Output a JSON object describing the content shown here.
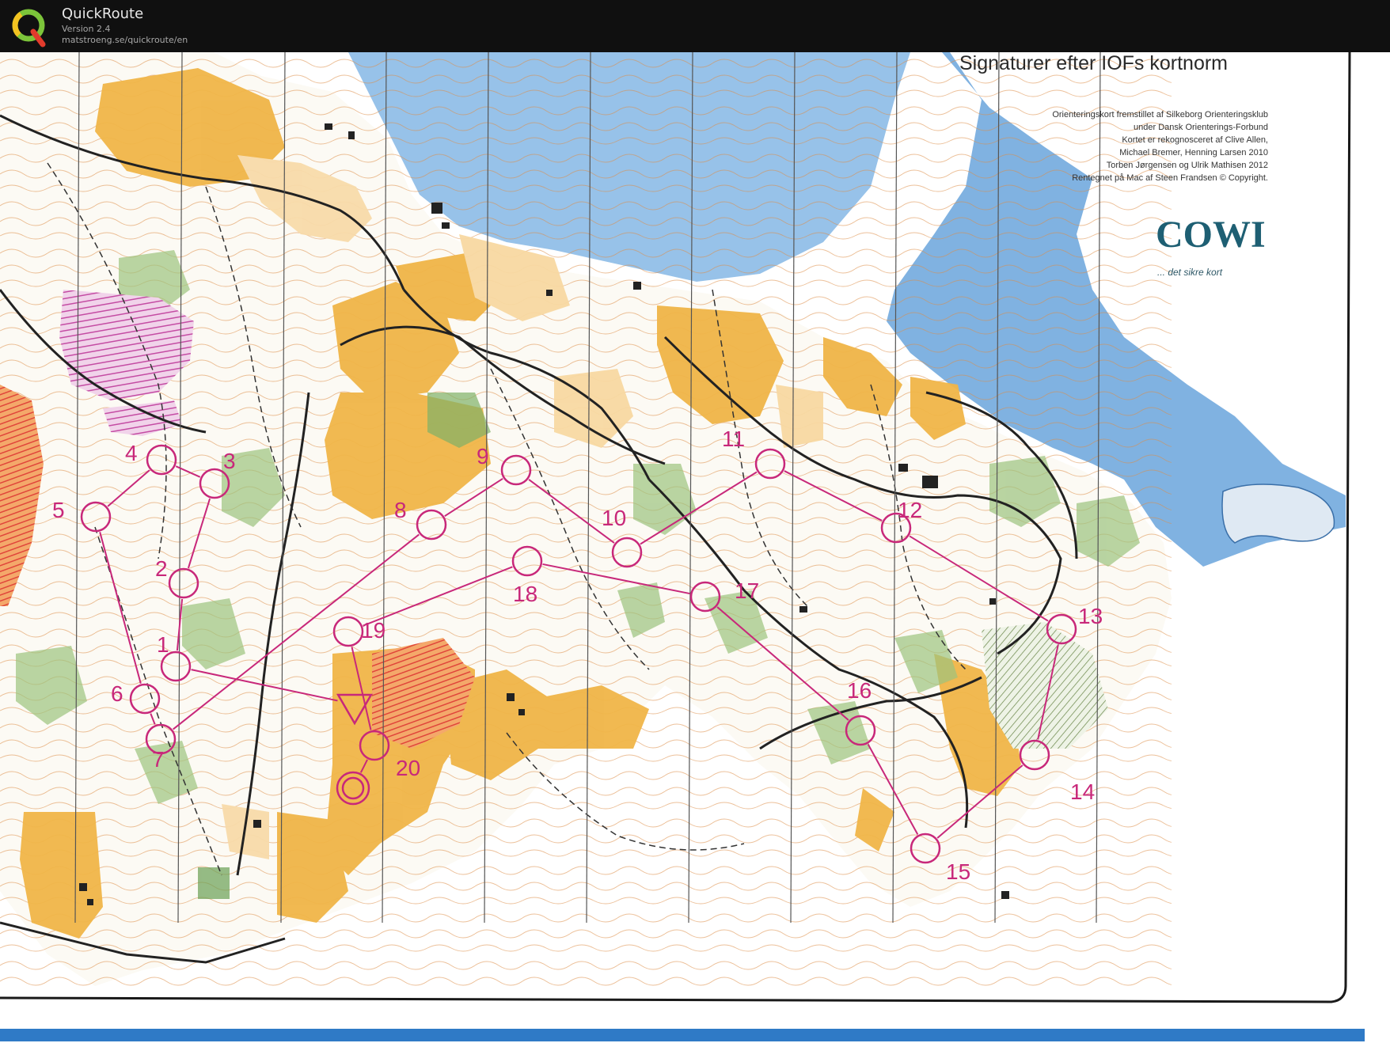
{
  "app": {
    "name": "QuickRoute",
    "version": "Version 2.4",
    "url": "matstroeng.se/quickroute/en",
    "logo_letter": "Q"
  },
  "map": {
    "legend_title": "Signaturer efter IOFs kortnorm",
    "credits": [
      "Orienteringskort fremstillet af Silkeborg Orienteringsklub",
      "under Dansk Orienterings-Forbund",
      "Kortet er rekognosceret af Clive Allen,",
      "Michael Bremer, Henning Larsen 2010",
      "Torben Jørgensen og Ulrik Mathisen 2012",
      "Rentegnet på Mac af Steen Frandsen   © Copyright."
    ],
    "publisher_logo": "COWI",
    "publisher_tagline": "... det sikre kort",
    "course_color": "#c8287a",
    "colors": {
      "forest": "#fbf8f2",
      "open_land": "#f0b548",
      "rough_open": "#f8d9a2",
      "vegetation": "#9cc37e",
      "water": "#4a8fd1",
      "contour": "#d9823a",
      "road": "#222222"
    },
    "controls": [
      {
        "number": "1"
      },
      {
        "number": "2"
      },
      {
        "number": "3"
      },
      {
        "number": "4"
      },
      {
        "number": "5"
      },
      {
        "number": "6"
      },
      {
        "number": "7"
      },
      {
        "number": "8"
      },
      {
        "number": "9"
      },
      {
        "number": "10"
      },
      {
        "number": "11"
      },
      {
        "number": "12"
      },
      {
        "number": "13"
      },
      {
        "number": "14"
      },
      {
        "number": "15"
      },
      {
        "number": "16"
      },
      {
        "number": "17"
      },
      {
        "number": "18"
      },
      {
        "number": "19"
      },
      {
        "number": "20"
      }
    ]
  }
}
